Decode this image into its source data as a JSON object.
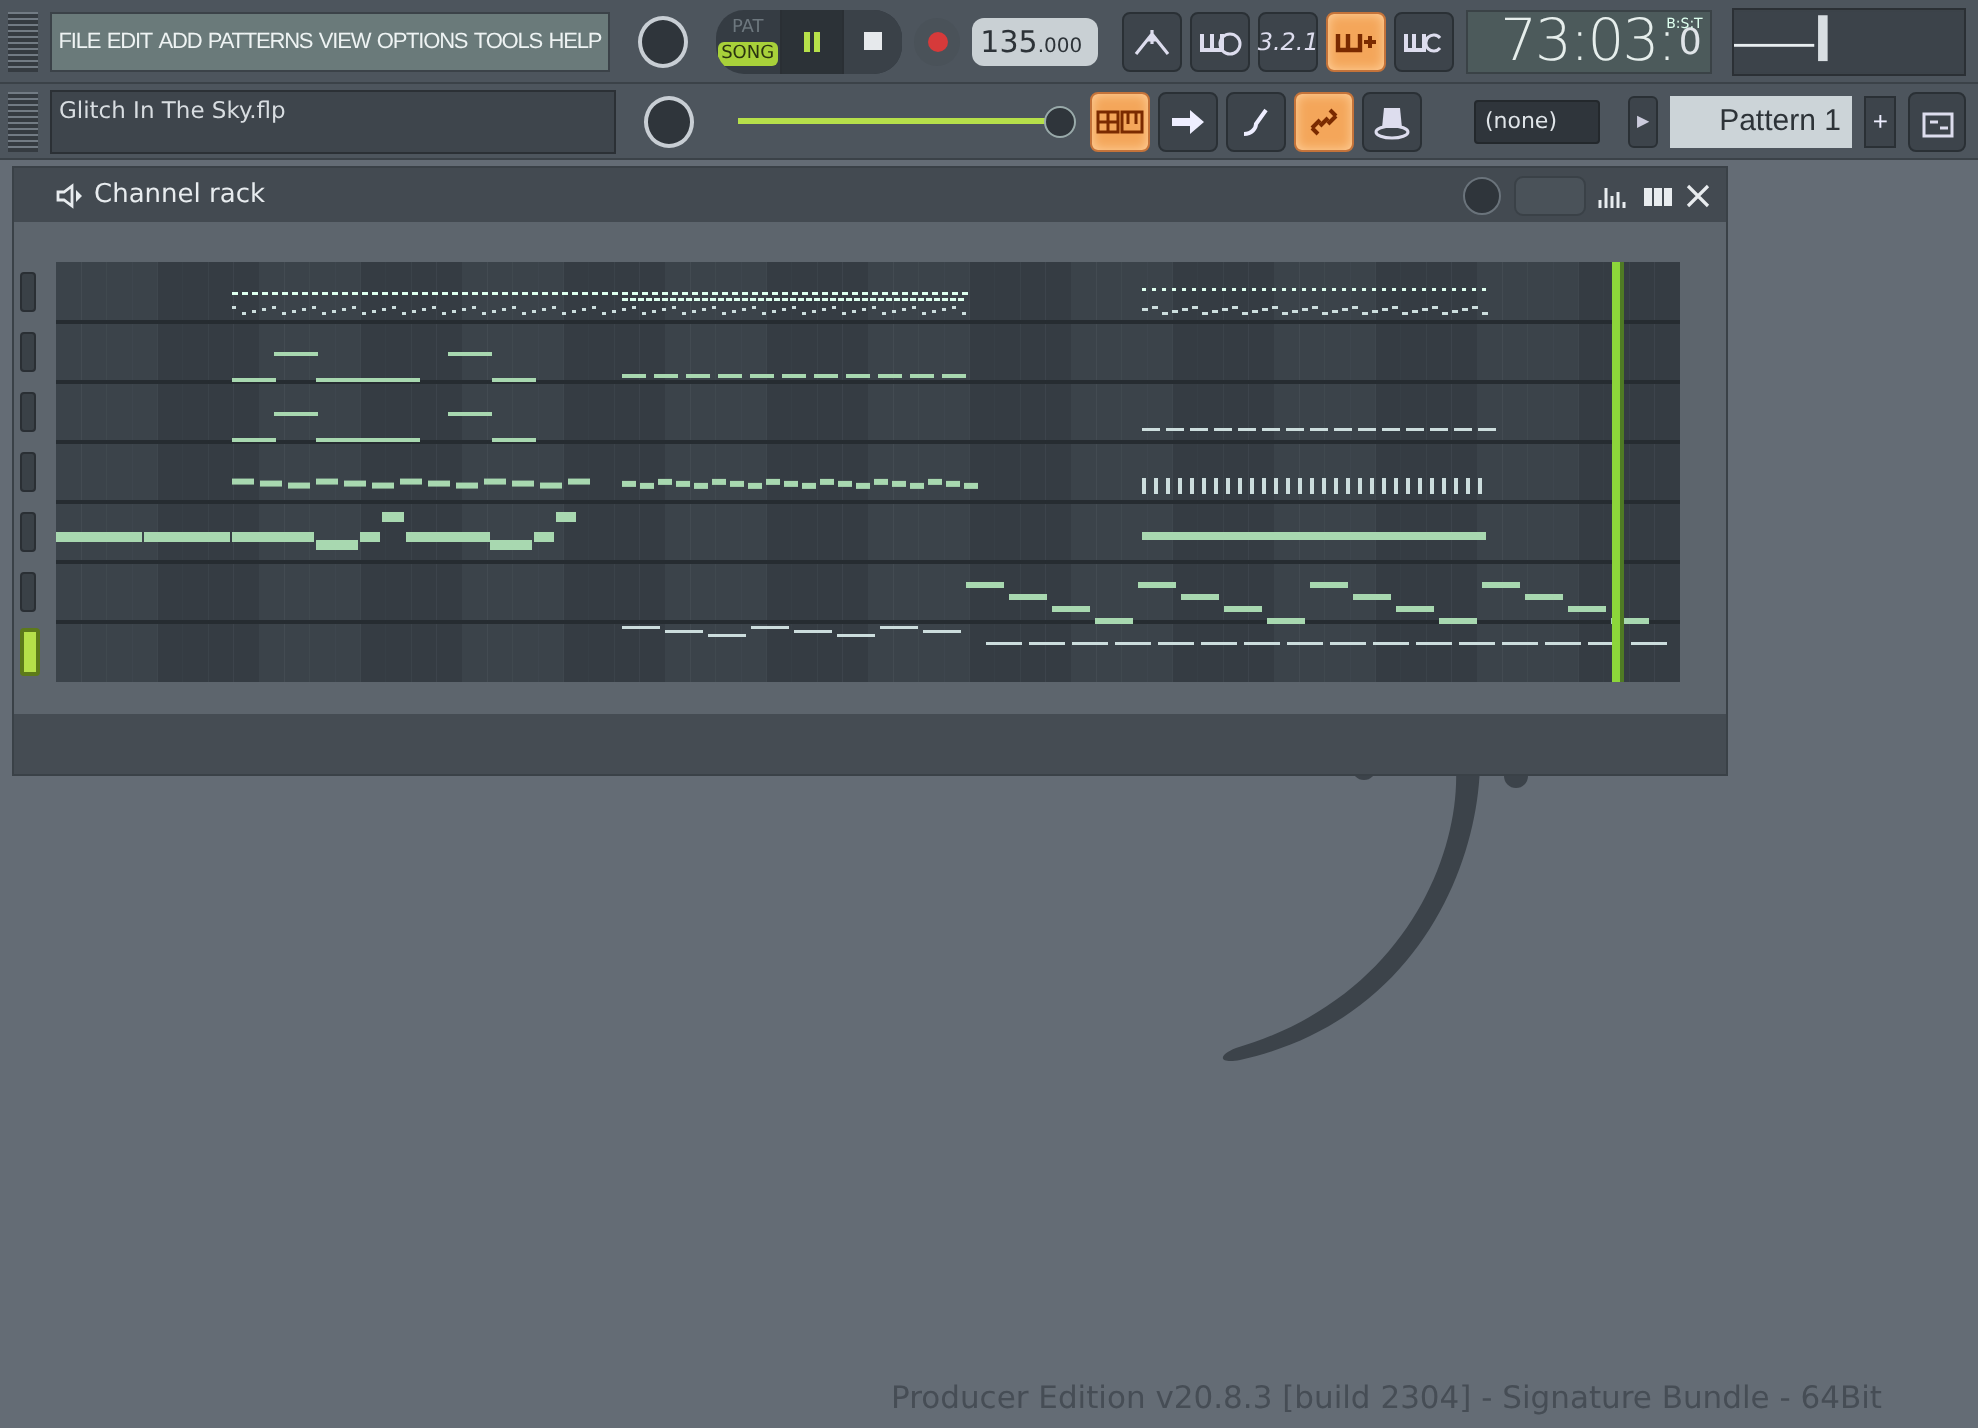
{
  "menu": [
    "FILE",
    "EDIT",
    "ADD",
    "PATTERNS",
    "VIEW",
    "OPTIONS",
    "TOOLS",
    "HELP"
  ],
  "transport": {
    "modes": [
      {
        "label": "PAT",
        "selected": false
      },
      {
        "label": "SONG",
        "selected": true
      }
    ],
    "playing": true,
    "recording": false,
    "tempo": "135",
    "tempo_fraction": ".000"
  },
  "toolbar_top": [
    {
      "kind": "metronome",
      "on": false
    },
    {
      "kind": "wait",
      "on": false
    },
    {
      "kind": "countdown",
      "label": "3.2.1",
      "on": false
    },
    {
      "kind": "blend",
      "on": true
    },
    {
      "kind": "loop",
      "on": false
    }
  ],
  "time": {
    "value": "73:03:",
    "ticks": "0",
    "format": "B:S:T"
  },
  "file": {
    "name": "Glitch In The Sky.flp"
  },
  "master_pitch": {
    "level": 0.97
  },
  "toolbar_bottom": [
    {
      "kind": "pianoroll",
      "on": true
    },
    {
      "kind": "arrow",
      "on": false
    },
    {
      "kind": "brush",
      "on": false
    },
    {
      "kind": "link",
      "on": true
    },
    {
      "kind": "plugin",
      "on": false
    }
  ],
  "snap": {
    "value": "(none)"
  },
  "pattern": {
    "menu_arrow": "▶",
    "name": "Pattern 1",
    "add": "+"
  },
  "channel_rack": {
    "title": "Channel rack",
    "channels": [
      {
        "selected": false
      },
      {
        "selected": false
      },
      {
        "selected": false
      },
      {
        "selected": false
      },
      {
        "selected": false
      },
      {
        "selected": false
      },
      {
        "selected": true
      }
    ]
  },
  "footer": "Producer Edition v20.8.3 [build 2304] - Signature Bundle - 64Bit"
}
